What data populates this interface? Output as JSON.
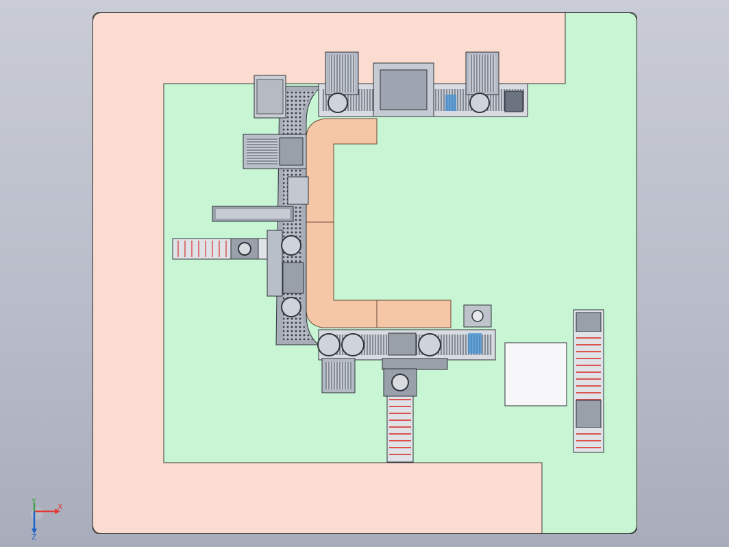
{
  "viewport": {
    "colors": {
      "background_top": "#c9ccd6",
      "background_bottom": "#a9adbb",
      "pink_zone": "#fadcd0",
      "green_zone": "#c8f5d4",
      "orange_zone": "#f5c7a6",
      "machine_gray": "#9aa0aa",
      "machine_dark": "#4a4f58",
      "rail_green": "#4caf50",
      "rail_red": "#d9534f",
      "rail_blue": "#3b8fd6"
    }
  },
  "triad": {
    "x_label": "X",
    "y_label": "Y",
    "z_label": "Z",
    "x_color": "#e53935",
    "y_color": "#43a047",
    "z_color": "#1e63c8"
  }
}
